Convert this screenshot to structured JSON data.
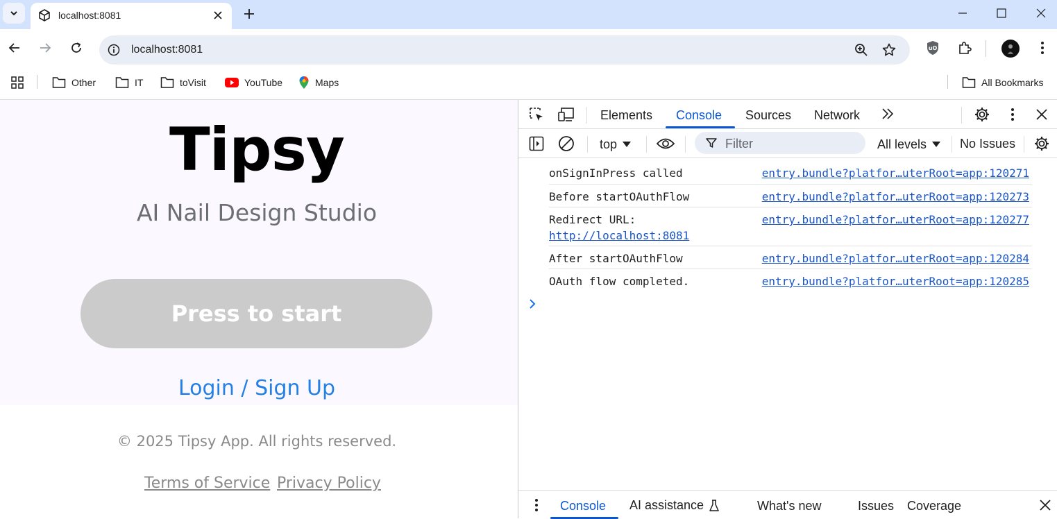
{
  "browser": {
    "tab": {
      "title": "localhost:8081"
    },
    "address_bar": {
      "url": "localhost:8081"
    },
    "bookmarks": [
      {
        "label": "Other",
        "icon": "folder-icon"
      },
      {
        "label": "IT",
        "icon": "folder-icon"
      },
      {
        "label": "toVisit",
        "icon": "folder-icon"
      },
      {
        "label": "YouTube",
        "icon": "youtube-icon"
      },
      {
        "label": "Maps",
        "icon": "maps-icon"
      }
    ],
    "all_bookmarks_label": "All Bookmarks"
  },
  "page": {
    "title": "Tipsy",
    "subtitle": "AI Nail Design Studio",
    "start_button": "Press to start",
    "login_link": "Login / Sign Up",
    "footer": {
      "copyright": "© 2025 Tipsy App. All rights reserved.",
      "terms": "Terms of Service",
      "privacy": "Privacy Policy"
    }
  },
  "devtools": {
    "tabs": [
      "Elements",
      "Console",
      "Sources",
      "Network"
    ],
    "active_tab": "Console",
    "context": "top",
    "filter_placeholder": "Filter",
    "levels": "All levels",
    "issues": "No Issues",
    "console_messages": [
      {
        "text": "onSignInPress called",
        "source": "entry.bundle?platfor…uterRoot=app:120271"
      },
      {
        "text": "Before startOAuthFlow",
        "source": "entry.bundle?platfor…uterRoot=app:120273"
      },
      {
        "text": "Redirect URL: ",
        "link": "http://localhost:8081",
        "source": "entry.bundle?platfor…uterRoot=app:120277"
      },
      {
        "text": "After startOAuthFlow",
        "source": "entry.bundle?platfor…uterRoot=app:120284"
      },
      {
        "text": "OAuth flow completed.",
        "source": "entry.bundle?platfor…uterRoot=app:120285"
      }
    ],
    "drawer_tabs": [
      "Console",
      "AI assistance",
      "What's new",
      "Issues",
      "Coverage"
    ],
    "colors": {
      "accent": "#0b57d0",
      "link": "#1a56c8"
    }
  }
}
